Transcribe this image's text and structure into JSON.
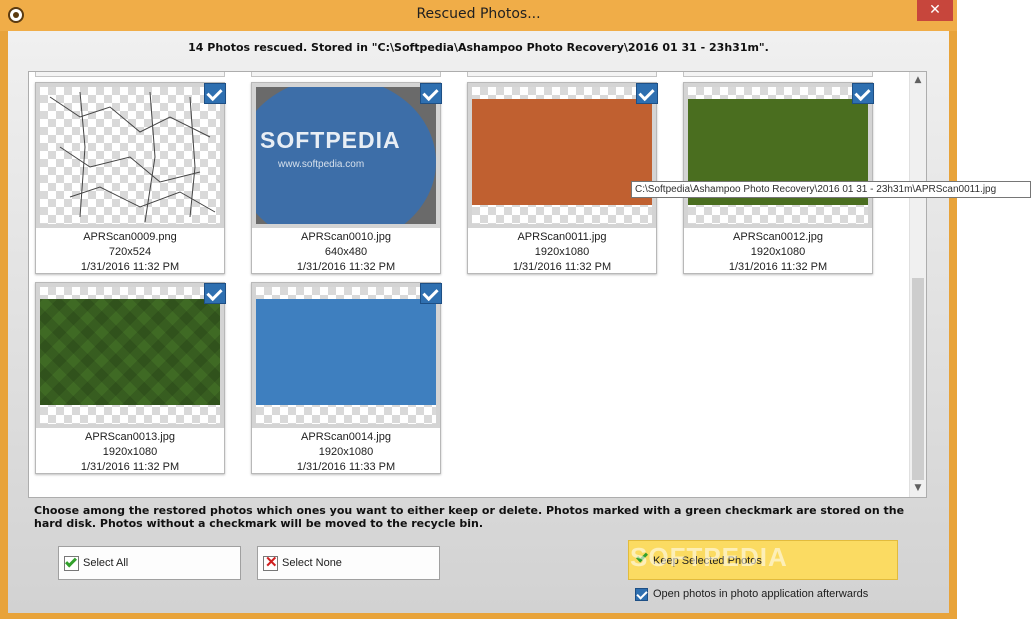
{
  "window": {
    "title": "Rescued Photos...",
    "close_glyph": "✕"
  },
  "header": {
    "message": "14 Photos rescued. Stored in \"C:\\Softpedia\\Ashampoo Photo Recovery\\2016 01 31 - 23h31m\"."
  },
  "photos": [
    {
      "name": "APRScan0009.png",
      "dimensions": "720x524",
      "date": "1/31/2016 11:32 PM",
      "checked": true,
      "fill": "map"
    },
    {
      "name": "APRScan0010.jpg",
      "dimensions": "640x480",
      "date": "1/31/2016 11:32 PM",
      "checked": true,
      "fill": "softpedia",
      "photo_text": "SOFTPEDIA",
      "photo_url": "www.softpedia.com"
    },
    {
      "name": "APRScan0011.jpg",
      "dimensions": "1920x1080",
      "date": "1/31/2016 11:32 PM",
      "checked": true,
      "fill": "#c06030"
    },
    {
      "name": "APRScan0012.jpg",
      "dimensions": "1920x1080",
      "date": "1/31/2016 11:32 PM",
      "checked": true,
      "fill": "#4a6e1f"
    },
    {
      "name": "APRScan0013.jpg",
      "dimensions": "1920x1080",
      "date": "1/31/2016 11:32 PM",
      "checked": true,
      "fill": "#3f6a24"
    },
    {
      "name": "APRScan0014.jpg",
      "dimensions": "1920x1080",
      "date": "1/31/2016 11:33 PM",
      "checked": true,
      "fill": "#3e7fbf"
    }
  ],
  "tooltip": "C:\\Softpedia\\Ashampoo Photo Recovery\\2016 01 31 - 23h31m\\APRScan0011.jpg",
  "instructions": "Choose among the restored photos which ones you want to either keep or delete. Photos marked with a green checkmark are stored on the hard disk. Photos without a checkmark will be moved to the recycle bin.",
  "buttons": {
    "select_all": "Select All",
    "select_none": "Select None",
    "keep_selected": "Keep Selected Photos"
  },
  "watermark": "SOFTPEDIA",
  "options": {
    "open_after": "Open photos in photo application afterwards",
    "open_after_checked": true
  },
  "colors": {
    "titlebar": "#f0ad48",
    "close": "#c7463c",
    "check_blue": "#2e6fb0",
    "keep_button": "#fbdb62"
  }
}
